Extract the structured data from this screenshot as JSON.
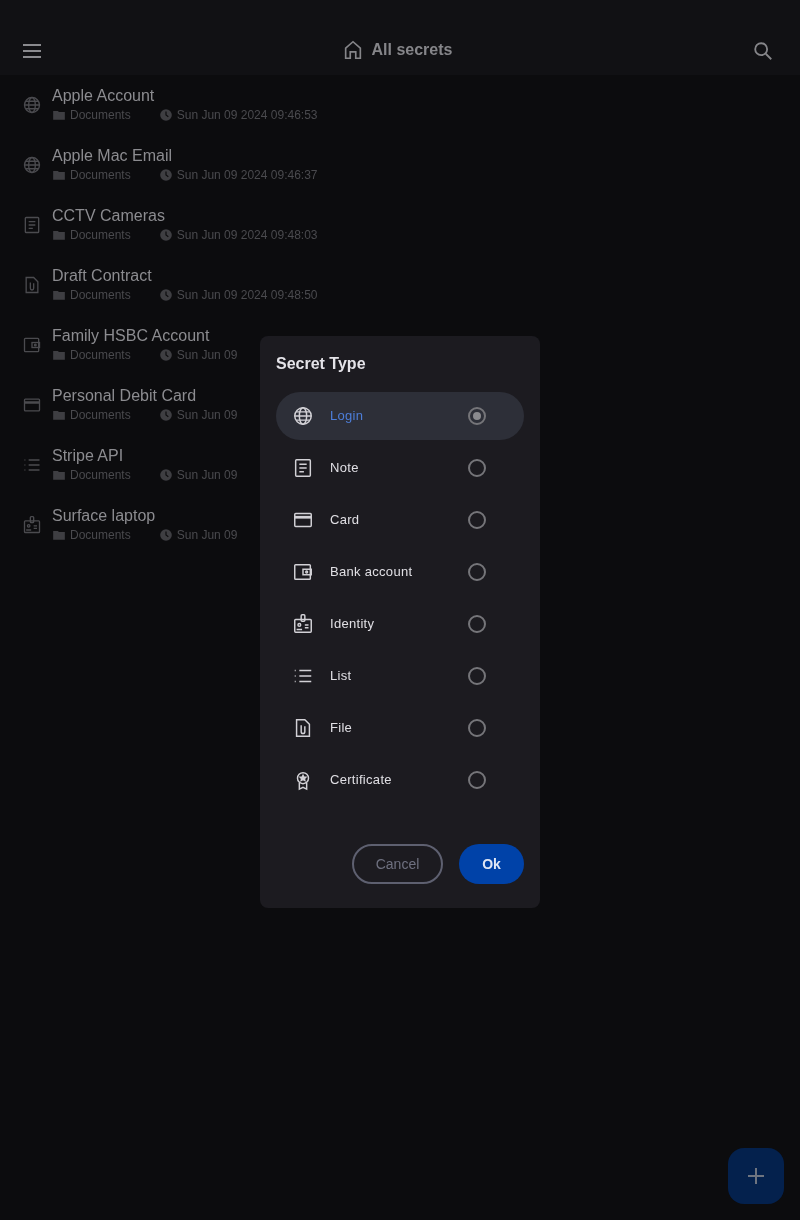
{
  "header": {
    "title": "All secrets"
  },
  "secrets": [
    {
      "kind": "login",
      "name": "Apple Account",
      "folder": "Documents",
      "date": "Sun Jun 09 2024 09:46:53"
    },
    {
      "kind": "login",
      "name": "Apple Mac Email",
      "folder": "Documents",
      "date": "Sun Jun 09 2024 09:46:37"
    },
    {
      "kind": "note",
      "name": "CCTV Cameras",
      "folder": "Documents",
      "date": "Sun Jun 09 2024 09:48:03"
    },
    {
      "kind": "file",
      "name": "Draft Contract",
      "folder": "Documents",
      "date": "Sun Jun 09 2024 09:48:50"
    },
    {
      "kind": "bank",
      "name": "Family HSBC Account",
      "folder": "Documents",
      "date": "Sun Jun 09"
    },
    {
      "kind": "card",
      "name": "Personal Debit Card",
      "folder": "Documents",
      "date": "Sun Jun 09"
    },
    {
      "kind": "list",
      "name": "Stripe API",
      "folder": "Documents",
      "date": "Sun Jun 09"
    },
    {
      "kind": "identity",
      "name": "Surface laptop",
      "folder": "Documents",
      "date": "Sun Jun 09"
    }
  ],
  "dialog": {
    "title": "Secret Type",
    "options": [
      {
        "kind": "login",
        "label": "Login",
        "selected": true
      },
      {
        "kind": "note",
        "label": "Note",
        "selected": false
      },
      {
        "kind": "card",
        "label": "Card",
        "selected": false
      },
      {
        "kind": "bank",
        "label": "Bank account",
        "selected": false
      },
      {
        "kind": "identity",
        "label": "Identity",
        "selected": false
      },
      {
        "kind": "list",
        "label": "List",
        "selected": false
      },
      {
        "kind": "file",
        "label": "File",
        "selected": false
      },
      {
        "kind": "certificate",
        "label": "Certificate",
        "selected": false
      }
    ],
    "buttons": [
      {
        "kind": "cancel",
        "label": "Cancel"
      },
      {
        "kind": "ok",
        "label": "Ok"
      }
    ]
  }
}
